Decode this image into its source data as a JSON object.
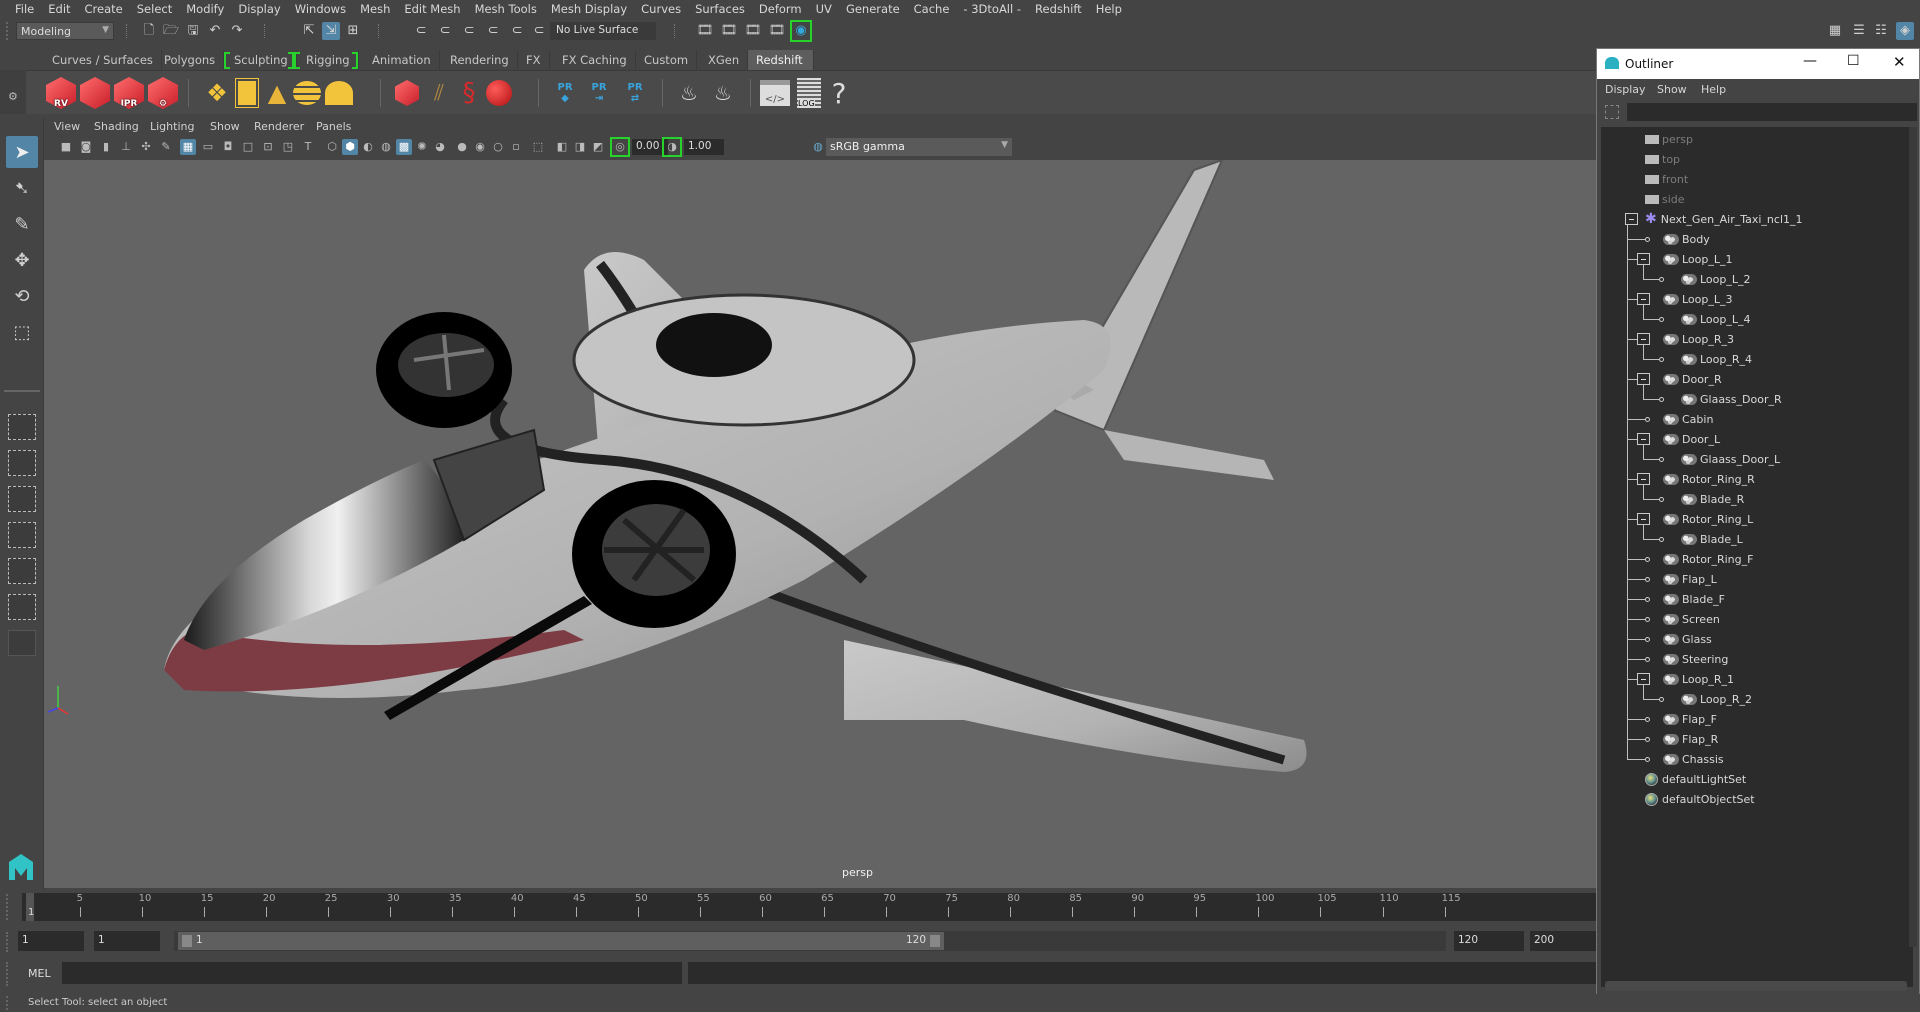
{
  "menubar": [
    "File",
    "Edit",
    "Create",
    "Select",
    "Modify",
    "Display",
    "Windows",
    "Mesh",
    "Edit Mesh",
    "Mesh Tools",
    "Mesh Display",
    "Curves",
    "Surfaces",
    "Deform",
    "UV",
    "Generate",
    "Cache",
    "- 3DtoAll -",
    "Redshift",
    "Help"
  ],
  "statusline": {
    "mode": "Modeling",
    "live_surface": "No Live Surface"
  },
  "shelf": {
    "tabs": [
      "Curves / Surfaces",
      "Polygons",
      "Sculpting",
      "Rigging",
      "Animation",
      "Rendering",
      "FX",
      "FX Caching",
      "Custom",
      "XGen",
      "Redshift"
    ],
    "active_tab": "Redshift",
    "buttons": [
      {
        "icon": "redshift-renderview-icon",
        "label": "RV"
      },
      {
        "icon": "redshift-batch-icon",
        "label": ""
      },
      {
        "icon": "redshift-ipr-icon",
        "label": "IPR"
      },
      {
        "icon": "redshift-settings-icon",
        "label": ""
      },
      {
        "icon": "rs-light-rect-icon",
        "label": ""
      },
      {
        "icon": "rs-light-portal-icon",
        "label": ""
      },
      {
        "icon": "rs-light-ies-icon",
        "label": ""
      },
      {
        "icon": "rs-dome-light-icon",
        "label": ""
      },
      {
        "icon": "rs-sun-sky-icon",
        "label": ""
      },
      {
        "icon": "rs-proxy-icon",
        "label": ""
      },
      {
        "icon": "rs-hair-icon",
        "label": ""
      },
      {
        "icon": "rs-volume-icon",
        "label": ""
      },
      {
        "icon": "rs-sphere-icon",
        "label": ""
      },
      {
        "icon": "pr-export-icon",
        "label": "PR"
      },
      {
        "icon": "pr-import-icon",
        "label": "PR"
      },
      {
        "icon": "pr-swap-icon",
        "label": "PR"
      },
      {
        "icon": "material-bowl-icon",
        "label": ""
      },
      {
        "icon": "material-bowl-2-icon",
        "label": ""
      },
      {
        "icon": "script-editor-icon",
        "label": ""
      },
      {
        "icon": "log-icon",
        "label": "LOG"
      },
      {
        "icon": "help-icon",
        "label": "?"
      }
    ]
  },
  "panel": {
    "menu": [
      "View",
      "Shading",
      "Lighting",
      "Show",
      "Renderer",
      "Panels"
    ],
    "exposure": "0.00",
    "gamma": "1.00",
    "color_management": "sRGB gamma",
    "camera_label": "persp"
  },
  "outliner": {
    "title": "Outliner",
    "menu": [
      "Display",
      "Show",
      "Help"
    ],
    "cameras": [
      "persp",
      "top",
      "front",
      "side"
    ],
    "root": "Next_Gen_Air_Taxi_ncl1_1",
    "items": [
      {
        "name": "Body",
        "level": 1,
        "expand": false
      },
      {
        "name": "Loop_L_1",
        "level": 1,
        "expand": true
      },
      {
        "name": "Loop_L_2",
        "level": 2,
        "expand": false
      },
      {
        "name": "Loop_L_3",
        "level": 1,
        "expand": true
      },
      {
        "name": "Loop_L_4",
        "level": 2,
        "expand": false
      },
      {
        "name": "Loop_R_3",
        "level": 1,
        "expand": true
      },
      {
        "name": "Loop_R_4",
        "level": 2,
        "expand": false
      },
      {
        "name": "Door_R",
        "level": 1,
        "expand": true
      },
      {
        "name": "Glaass_Door_R",
        "level": 2,
        "expand": false
      },
      {
        "name": "Cabin",
        "level": 1,
        "expand": false
      },
      {
        "name": "Door_L",
        "level": 1,
        "expand": true
      },
      {
        "name": "Glaass_Door_L",
        "level": 2,
        "expand": false
      },
      {
        "name": "Rotor_Ring_R",
        "level": 1,
        "expand": true
      },
      {
        "name": "Blade_R",
        "level": 2,
        "expand": false
      },
      {
        "name": "Rotor_Ring_L",
        "level": 1,
        "expand": true
      },
      {
        "name": "Blade_L",
        "level": 2,
        "expand": false
      },
      {
        "name": "Rotor_Ring_F",
        "level": 1,
        "expand": false
      },
      {
        "name": "Flap_L",
        "level": 1,
        "expand": false
      },
      {
        "name": "Blade_F",
        "level": 1,
        "expand": false
      },
      {
        "name": "Screen",
        "level": 1,
        "expand": false
      },
      {
        "name": "Glass",
        "level": 1,
        "expand": false
      },
      {
        "name": "Steering",
        "level": 1,
        "expand": false
      },
      {
        "name": "Loop_R_1",
        "level": 1,
        "expand": true
      },
      {
        "name": "Loop_R_2",
        "level": 2,
        "expand": false
      },
      {
        "name": "Flap_F",
        "level": 1,
        "expand": false
      },
      {
        "name": "Flap_R",
        "level": 1,
        "expand": false
      },
      {
        "name": "Chassis",
        "level": 1,
        "expand": false
      }
    ],
    "sets": [
      "defaultLightSet",
      "defaultObjectSet"
    ]
  },
  "timeline": {
    "ticks": [
      5,
      10,
      15,
      20,
      25,
      30,
      35,
      40,
      45,
      50,
      55,
      60,
      65,
      70,
      75,
      80,
      85,
      90,
      95,
      100,
      105,
      110,
      115
    ],
    "current_frame": "1",
    "start": 1,
    "end": 120
  },
  "range": {
    "anim_start": "1",
    "playback_start": "1",
    "slider_start": "1",
    "slider_end": "120",
    "playback_end": "120",
    "anim_end": "200"
  },
  "mel_label": "MEL",
  "help_line": "Select Tool: select an object",
  "colors": {
    "accent": "#5285a6",
    "highlight_green": "#27d32a",
    "viewport_bg": "#646464",
    "redshift_red": "#d8262f"
  }
}
